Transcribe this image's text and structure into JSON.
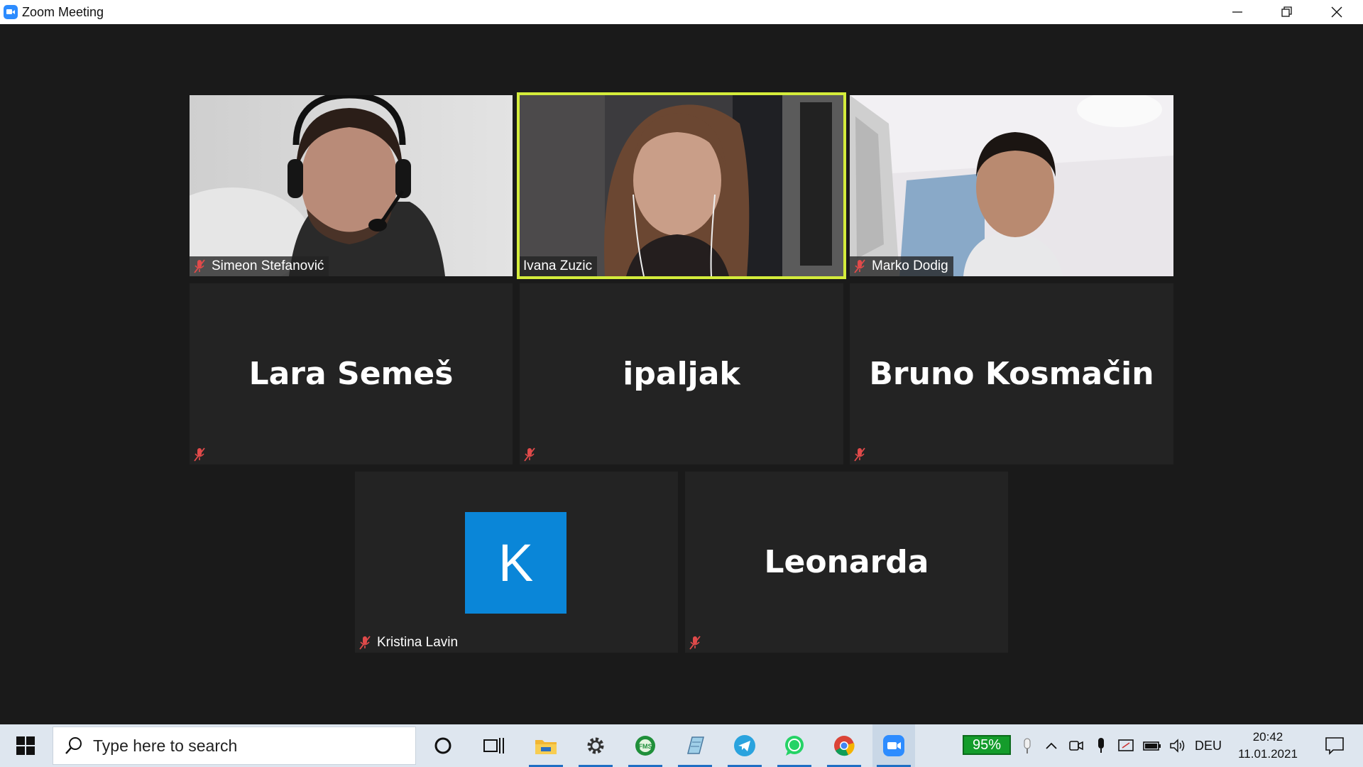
{
  "window": {
    "title": "Zoom Meeting"
  },
  "participants": [
    {
      "name": "Simeon Stefanović",
      "video": true,
      "muted": true
    },
    {
      "name": "Ivana Zuzic",
      "video": true,
      "muted": false,
      "active_speaker": true
    },
    {
      "name": "Marko Dodig",
      "video": true,
      "muted": true
    },
    {
      "name": "Lara Semeš",
      "video": false,
      "muted": true
    },
    {
      "name": "ipaljak",
      "video": false,
      "muted": true
    },
    {
      "name": "Bruno Kosmačin",
      "video": false,
      "muted": true
    },
    {
      "name": "Kristina Lavin",
      "video": false,
      "muted": true,
      "avatar_letter": "K"
    },
    {
      "name": "Leonarda",
      "video": false,
      "muted": true
    }
  ],
  "taskbar": {
    "search_placeholder": "Type here to search",
    "pinned_apps": [
      "cortana-icon",
      "task-view-icon",
      "file-explorer-icon",
      "settings-icon",
      "fms-icon",
      "notepad-icon",
      "telegram-icon",
      "whatsapp-icon",
      "chrome-icon",
      "zoom-icon"
    ],
    "battery_percent": "95%",
    "language": "DEU",
    "time": "20:42",
    "date": "11.01.2021"
  },
  "colors": {
    "active_speaker_border": "#d4ec3b",
    "avatar_bg": "#0a86d8",
    "muted_mic": "#e04a4a",
    "battery_green": "#149c2b"
  }
}
